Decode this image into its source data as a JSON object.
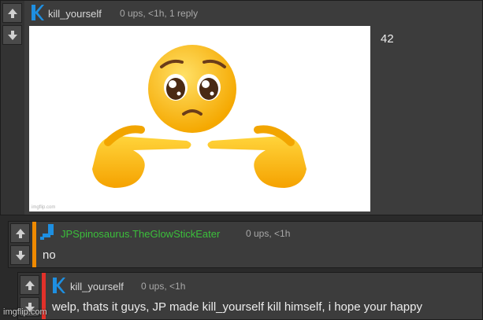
{
  "comments": [
    {
      "username": "kill_yourself",
      "meta": "0 ups, <1h, 1 reply",
      "image_text": "42",
      "image_footer": "imgflip.com",
      "avatar_icon": "k-avatar-icon",
      "username_color": "#d8d8d8"
    },
    {
      "username": "JPSpinosaurus.TheGlowStickEater",
      "meta": "0 ups, <1h",
      "text": "no",
      "avatar_icon": "jp-avatar-icon",
      "username_color": "#3bbf3b",
      "stripe_color": "#ef8a00"
    },
    {
      "username": "kill_yourself",
      "meta": "0 ups, <1h",
      "text": "welp, thats it guys, JP made kill_yourself kill himself, i hope your happy",
      "avatar_icon": "k-avatar-icon",
      "username_color": "#d8d8d8",
      "stripe_color": "#e2312a"
    }
  ],
  "watermark": "imgflip.com",
  "colors": {
    "background": "#2a2a2a",
    "panel": "#3c3c3c",
    "avatar_blue": "#1e8fe1"
  }
}
